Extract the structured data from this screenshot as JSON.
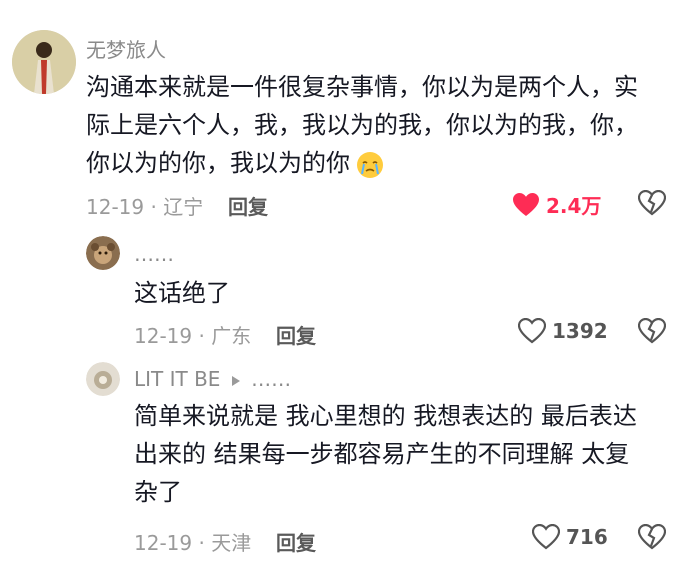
{
  "comments": [
    {
      "username": "无梦旅人",
      "text": "沟通本来就是一件很复杂事情，你以为是两个人，实际上是六个人，我，我以为的我，你以为的我，你，你以为的你，我以为的你",
      "emoji": "crying-face-icon",
      "date": "12-19",
      "location": "辽宁",
      "reply_label": "回复",
      "likes": "2.4万",
      "liked": true
    },
    {
      "username": "……",
      "text": "这话绝了",
      "date": "12-19",
      "location": "广东",
      "reply_label": "回复",
      "likes": "1392",
      "liked": false
    },
    {
      "username": "LIT IT BE",
      "reply_to": "……",
      "text": "简单来说就是 我心里想的 我想表达的 最后表达出来的 结果每一步都容易产生的不同理解 太复杂了",
      "date": "12-19",
      "location": "天津",
      "reply_label": "回复",
      "likes": "716",
      "liked": false
    }
  ],
  "colors": {
    "like_active": "#fe2c55",
    "icon_gray": "#555555",
    "meta_gray": "#9a9a9a"
  }
}
